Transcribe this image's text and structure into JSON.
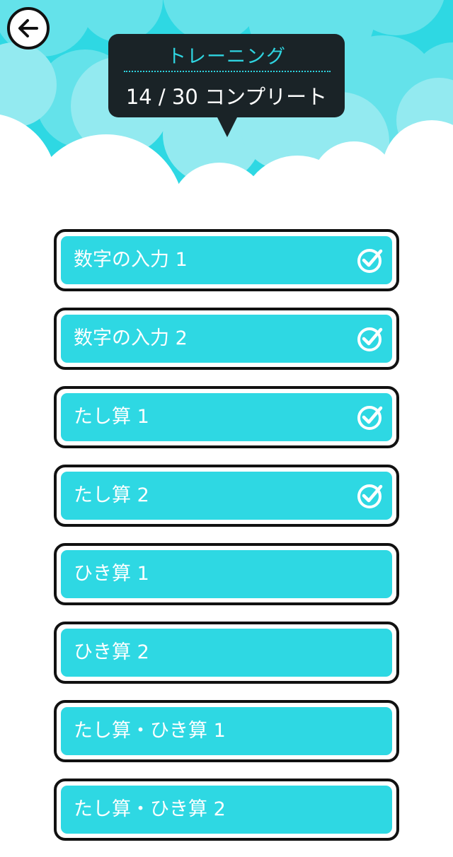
{
  "header": {
    "back_icon": "arrow-left-icon",
    "section_title": "トレーニング",
    "progress_text": "14 / 30 コンプリート"
  },
  "colors": {
    "sky": "#2ed8e3",
    "button_fill": "#2ed8e3",
    "tooltip_bg": "#1a2327",
    "tooltip_accent": "#2fd4e0"
  },
  "training_list": [
    {
      "label": "数字の入力 1",
      "completed": true
    },
    {
      "label": "数字の入力 2",
      "completed": true
    },
    {
      "label": "たし算 1",
      "completed": true
    },
    {
      "label": "たし算 2",
      "completed": true
    },
    {
      "label": "ひき算 1",
      "completed": false
    },
    {
      "label": "ひき算 2",
      "completed": false
    },
    {
      "label": "たし算・ひき算 1",
      "completed": false
    },
    {
      "label": "たし算・ひき算 2",
      "completed": false
    }
  ]
}
